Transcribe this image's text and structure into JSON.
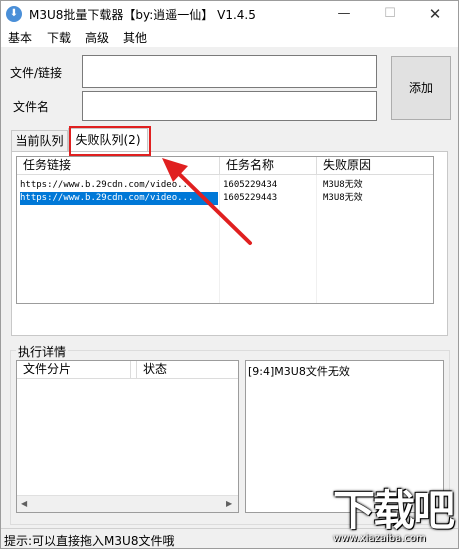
{
  "window": {
    "title": "M3U8批量下载器【by:逍遥一仙】 V1.4.5",
    "min_glyph": "—",
    "max_glyph": "☐",
    "close_glyph": "✕"
  },
  "menu": [
    "基本",
    "下载",
    "高级",
    "其他"
  ],
  "form": {
    "file_label": "文件/链接",
    "file_value": "",
    "name_label": "文件名",
    "name_value": "",
    "add_button": "添加"
  },
  "tabs": [
    {
      "label": "当前队列",
      "active": false
    },
    {
      "label": "失败队列(2)",
      "active": true
    }
  ],
  "failed_list": {
    "columns": [
      "任务链接",
      "任务名称",
      "失败原因"
    ],
    "rows": [
      {
        "link": "https://www.b.29cdn.com/video...",
        "name": "1605229434",
        "reason": "M3U8无效",
        "selected": false
      },
      {
        "link": "https://www.b.29cdn.com/video...",
        "name": "1605229443",
        "reason": "M3U8无效",
        "selected": true
      }
    ]
  },
  "details": {
    "group_label": "执行详情",
    "columns": [
      "文件分片",
      "状态"
    ],
    "log_text": "[9:4]M3U8文件无效"
  },
  "status_bar": {
    "text": "提示:可以直接拖入M3U8文件哦"
  },
  "watermark": {
    "main": "下载吧",
    "sub": "www.xiazaiba.com"
  },
  "annotation": {
    "color": "#e02020"
  }
}
